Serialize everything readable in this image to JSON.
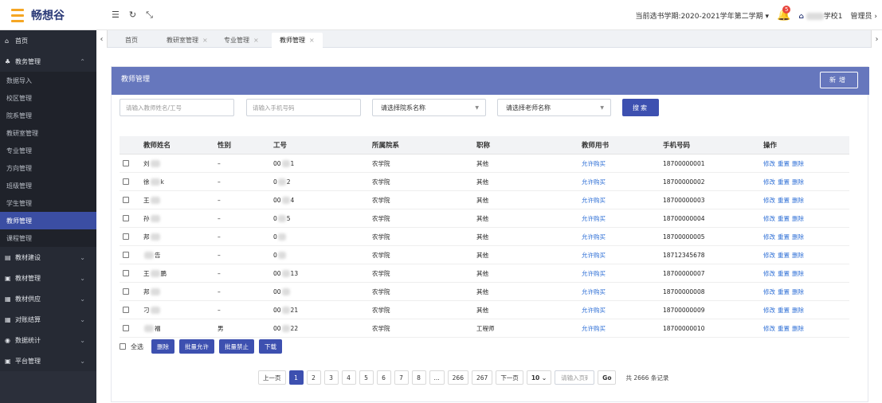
{
  "header": {
    "logo_title": "畅想谷",
    "term": "当前选书学期:2020-2021学年第二学期",
    "bell_count": "5",
    "school_suffix": "学校1",
    "user": "管理员"
  },
  "sidebar": {
    "items": [
      {
        "icon": "home-icon",
        "label": "首页",
        "level": "top"
      },
      {
        "icon": "org-icon",
        "label": "教务管理",
        "level": "group",
        "chev": "^"
      },
      {
        "label": "数据导入",
        "level": "sub"
      },
      {
        "label": "校区管理",
        "level": "sub"
      },
      {
        "label": "院系管理",
        "level": "sub"
      },
      {
        "label": "教研室管理",
        "level": "sub"
      },
      {
        "label": "专业管理",
        "level": "sub"
      },
      {
        "label": "方向管理",
        "level": "sub"
      },
      {
        "label": "班级管理",
        "level": "sub"
      },
      {
        "label": "学生管理",
        "level": "sub"
      },
      {
        "label": "教师管理",
        "level": "sub",
        "active": true
      },
      {
        "label": "课程管理",
        "level": "sub"
      },
      {
        "icon": "book-icon",
        "label": "教材建设",
        "level": "group",
        "chev": "v"
      },
      {
        "icon": "book-manage-icon",
        "label": "教材管理",
        "level": "group",
        "chev": "v"
      },
      {
        "icon": "supply-icon",
        "label": "教材供应",
        "level": "group",
        "chev": "v"
      },
      {
        "icon": "grid-icon",
        "label": "对账结算",
        "level": "group",
        "chev": "v"
      },
      {
        "icon": "stats-icon",
        "label": "数据统计",
        "level": "group",
        "chev": "v"
      },
      {
        "icon": "platform-icon",
        "label": "平台管理",
        "level": "group",
        "chev": "v"
      }
    ]
  },
  "tabs": [
    {
      "label": "首页",
      "closable": false
    },
    {
      "label": "教研室管理",
      "closable": true
    },
    {
      "label": "专业管理",
      "closable": true
    },
    {
      "label": "教师管理",
      "closable": true,
      "active": true
    }
  ],
  "panel": {
    "title": "教师管理",
    "add_label": "新增"
  },
  "filters": {
    "name_placeholder": "请输入教师姓名/工号",
    "phone_placeholder": "请输入手机号码",
    "dept_select": "请选择院系名称",
    "teacher_select": "请选择老师名称",
    "search_label": "搜索"
  },
  "table": {
    "headers": [
      "教师姓名",
      "性别",
      "工号",
      "所属院系",
      "职称",
      "教师用书",
      "手机号码",
      "操作"
    ],
    "rows": [
      {
        "name": "刘",
        "name_end": "",
        "gender": "–",
        "id_start": "00",
        "id_end": "1",
        "dept": "农学院",
        "title": "其他",
        "book": "允许购买",
        "phone": "18700000001"
      },
      {
        "name": "徐",
        "name_end": "k",
        "gender": "–",
        "id_start": "0",
        "id_end": "2",
        "dept": "农学院",
        "title": "其他",
        "book": "允许购买",
        "phone": "18700000002"
      },
      {
        "name": "王",
        "name_end": "",
        "gender": "–",
        "id_start": "00",
        "id_end": "4",
        "dept": "农学院",
        "title": "其他",
        "book": "允许购买",
        "phone": "18700000003"
      },
      {
        "name": "孙",
        "name_end": "",
        "gender": "–",
        "id_start": "0",
        "id_end": "5",
        "dept": "农学院",
        "title": "其他",
        "book": "允许购买",
        "phone": "18700000004"
      },
      {
        "name": "邦",
        "name_end": "",
        "gender": "–",
        "id_start": "0",
        "id_end": "",
        "dept": "农学院",
        "title": "其他",
        "book": "允许购买",
        "phone": "18700000005"
      },
      {
        "name": "",
        "name_end": "告",
        "gender": "–",
        "id_start": "0",
        "id_end": "",
        "dept": "农学院",
        "title": "其他",
        "book": "允许购买",
        "phone": "18712345678"
      },
      {
        "name": "王",
        "name_end": "鹏",
        "gender": "–",
        "id_start": "00",
        "id_end": "13",
        "dept": "农学院",
        "title": "其他",
        "book": "允许购买",
        "phone": "18700000007"
      },
      {
        "name": "邦",
        "name_end": "",
        "gender": "–",
        "id_start": "00",
        "id_end": "",
        "dept": "农学院",
        "title": "其他",
        "book": "允许购买",
        "phone": "18700000008"
      },
      {
        "name": "刁",
        "name_end": "",
        "gender": "–",
        "id_start": "00",
        "id_end": "21",
        "dept": "农学院",
        "title": "其他",
        "book": "允许购买",
        "phone": "18700000009"
      },
      {
        "name": "",
        "name_end": "福",
        "gender": "男",
        "id_start": "00",
        "id_end": "22",
        "dept": "农学院",
        "title": "工程师",
        "book": "允许购买",
        "phone": "18700000010"
      }
    ],
    "ops": [
      "修改",
      "重置",
      "删除"
    ]
  },
  "batch": {
    "select_all": "全选",
    "delete": "删除",
    "allow": "批量允许",
    "forbid": "批量禁止",
    "download": "下载"
  },
  "pager": {
    "prev": "上一页",
    "pages": [
      "1",
      "2",
      "3",
      "4",
      "5",
      "6",
      "7",
      "8",
      "...",
      "266",
      "267"
    ],
    "current": "1",
    "next": "下一页",
    "size": "10",
    "goto_placeholder": "请输入页码",
    "go": "Go",
    "total": "共 2666 条记录"
  },
  "colors": {
    "accent": "#3d50b0",
    "panel_head": "#6677bd",
    "sidebar": "#2b2f3a",
    "link": "#2e6fd6"
  }
}
